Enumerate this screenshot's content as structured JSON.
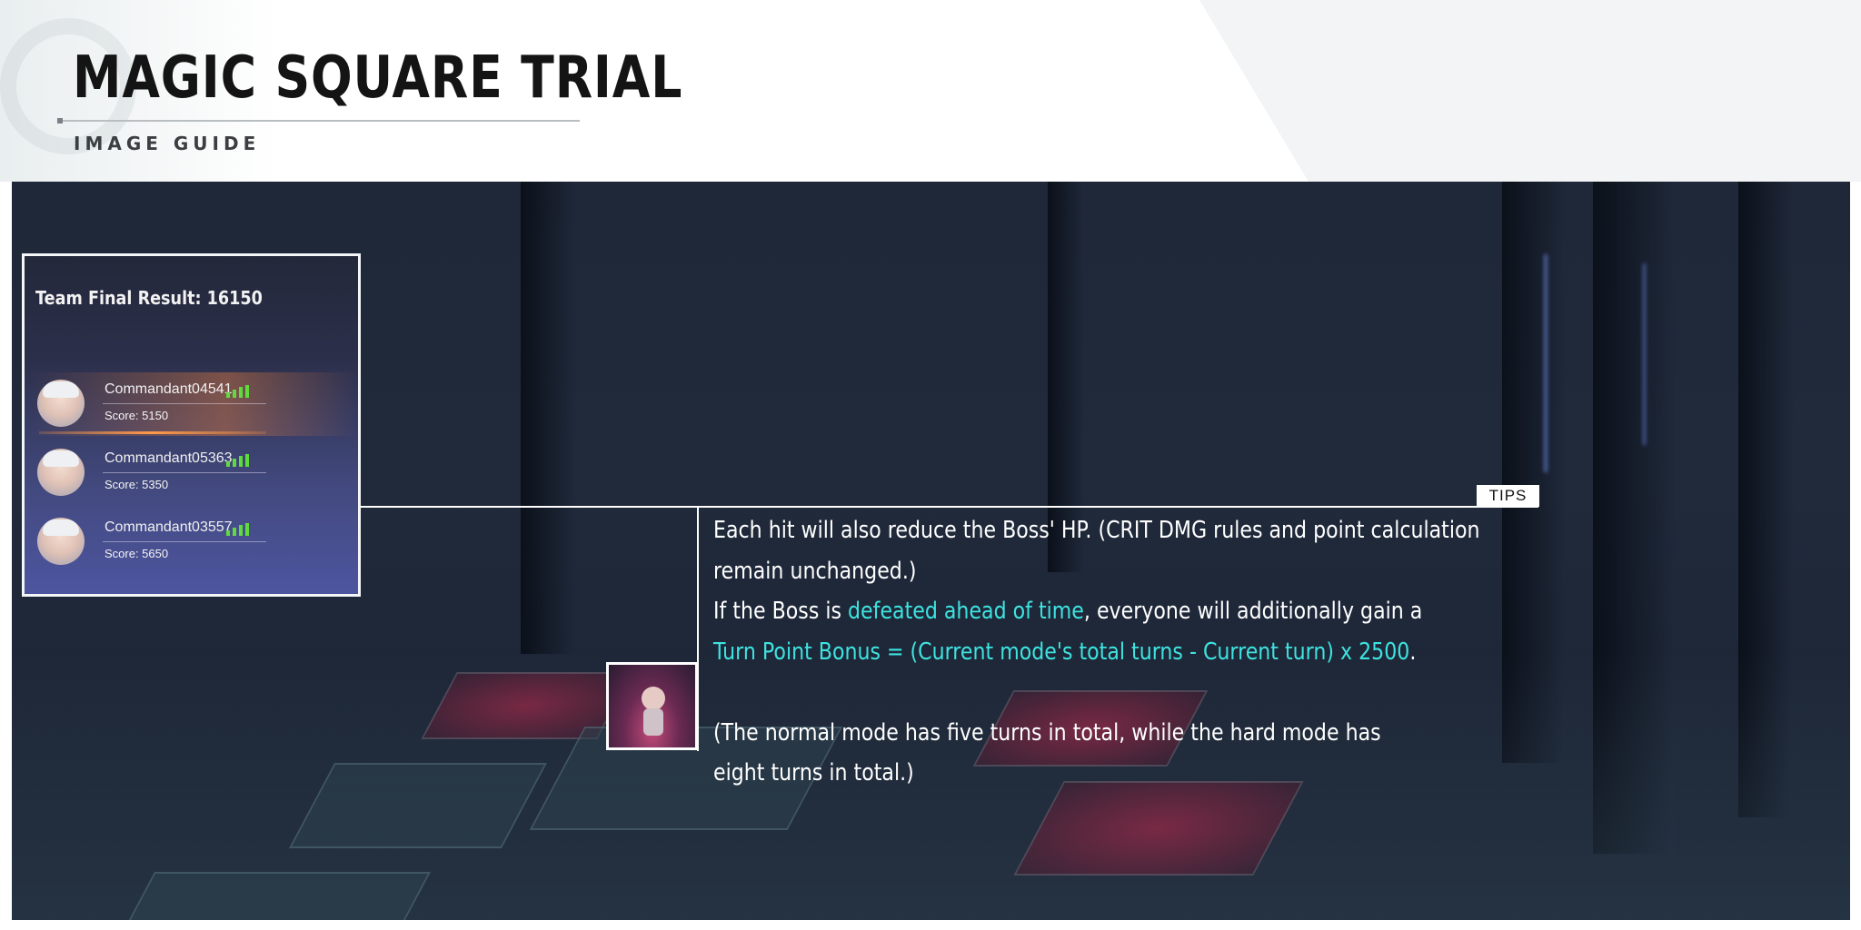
{
  "header": {
    "title": "MAGIC SQUARE TRIAL",
    "subtitle": "IMAGE GUIDE"
  },
  "result_panel": {
    "title": "Team Final Result: 16150",
    "players": [
      {
        "name": "Commandant04541",
        "score": "Score:  5150",
        "highlighted": true,
        "signal_color": "#5fdc3c"
      },
      {
        "name": "Commandant05363",
        "score": "Score:  5350",
        "highlighted": false,
        "signal_color": "#5fdc3c"
      },
      {
        "name": "Commandant03557",
        "score": "Score:  5650",
        "highlighted": false,
        "signal_color": "#5fdc3c"
      }
    ]
  },
  "tips": {
    "tag": "TIPS",
    "line1": "Each hit will also reduce the Boss' HP. (CRIT DMG rules and point calculation",
    "line2": "remain unchanged.)",
    "line3_prefix": "If the Boss is ",
    "line3_highlight": "defeated ahead of time",
    "line3_suffix": ", everyone will additionally gain a",
    "line4_highlight": "Turn Point Bonus = (Current mode's total turns - Current turn) x 2500",
    "line4_suffix": ".",
    "line5": "(The normal mode has five turns in total, while the hard mode has",
    "line6": "eight turns in total.)"
  },
  "colors": {
    "highlight_text": "#3ee3e0",
    "panel_border": "#f4f6f8",
    "signal": "#5fdc3c"
  }
}
